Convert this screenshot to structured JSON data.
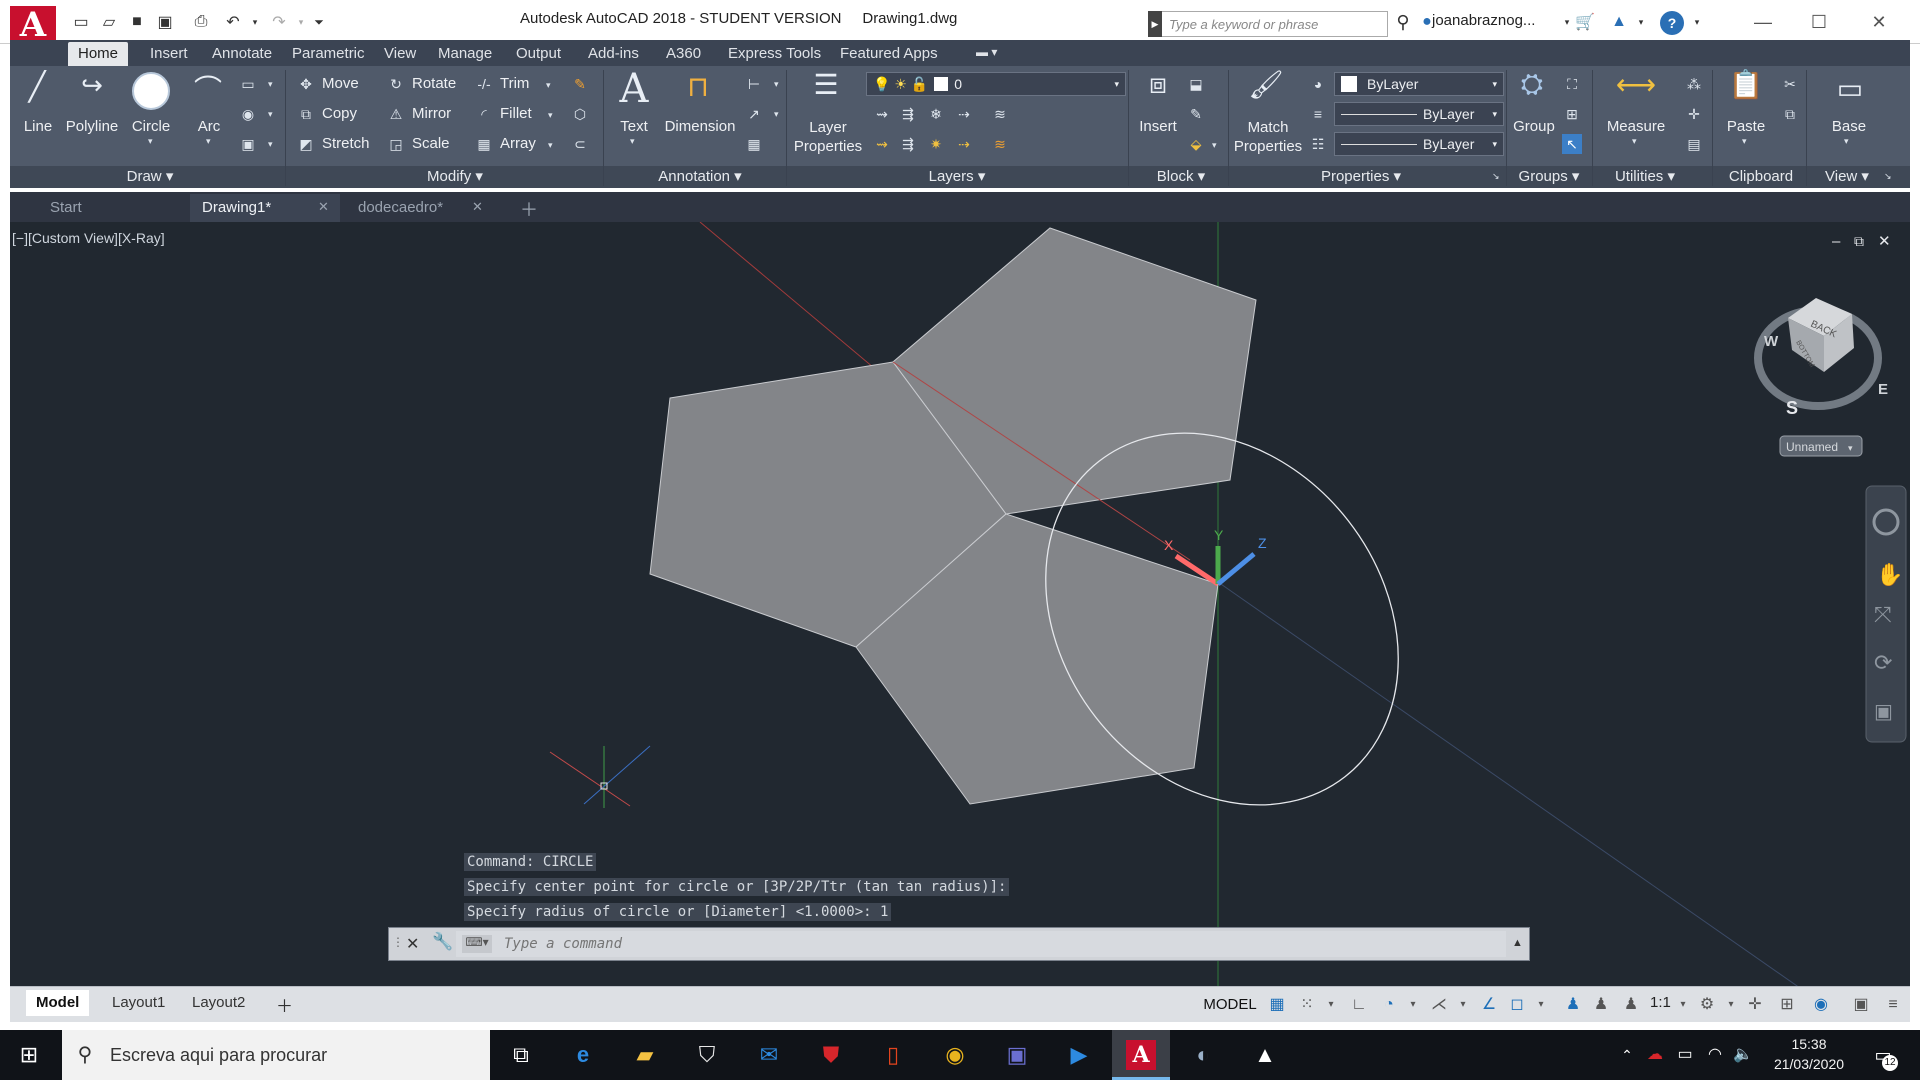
{
  "window": {
    "title": "Autodesk AutoCAD 2018 - STUDENT VERSION     Drawing1.dwg",
    "app_logo": "A",
    "search_placeholder": "Type a keyword or phrase",
    "username": "joanabraznog...",
    "help": "?"
  },
  "ribbon_tabs": [
    "Home",
    "Insert",
    "Annotate",
    "Parametric",
    "View",
    "Manage",
    "Output",
    "Add-ins",
    "A360",
    "Express Tools",
    "Featured Apps"
  ],
  "draw_panel": {
    "title": "Draw",
    "tools": [
      "Line",
      "Polyline",
      "Circle",
      "Arc"
    ]
  },
  "modify_panel": {
    "title": "Modify",
    "tools": [
      "Move",
      "Rotate",
      "Trim",
      "Copy",
      "Mirror",
      "Fillet",
      "Stretch",
      "Scale",
      "Array"
    ]
  },
  "annotation_panel": {
    "title": "Annotation",
    "tools": [
      "Text",
      "Dimension"
    ]
  },
  "layers_panel": {
    "title": "Layers",
    "layer_properties": "Layer\nProperties",
    "current_layer": "0"
  },
  "block_panel": {
    "title": "Block",
    "insert": "Insert"
  },
  "properties_panel": {
    "title": "Properties",
    "match_properties": "Match\nProperties",
    "color": "ByLayer",
    "linetype": "ByLayer",
    "lineweight": "ByLayer"
  },
  "groups_panel": {
    "title": "Groups",
    "group": "Group"
  },
  "utilities_panel": {
    "title": "Utilities",
    "measure": "Measure"
  },
  "clipboard_panel": {
    "title": "Clipboard",
    "paste": "Paste"
  },
  "view_panel": {
    "title": "View",
    "base": "Base"
  },
  "file_tabs": [
    "Start",
    "Drawing1*",
    "dodecaedro*"
  ],
  "viewport": {
    "label": "[−][Custom View][X-Ray]",
    "viewcube_face": "BACK",
    "viewcube_side": "BOTTOM",
    "compass": [
      "W",
      "E",
      "S"
    ],
    "ucs_name": "Unnamed",
    "ucs_axes": [
      "X",
      "Y",
      "Z"
    ]
  },
  "command_history": [
    "Command: CIRCLE",
    "Specify center point for circle or [3P/2P/Ttr (tan tan radius)]:",
    "Specify radius of circle or [Diameter] <1.0000>: 1"
  ],
  "command_placeholder": "Type a command",
  "layout_tabs": [
    "Model",
    "Layout1",
    "Layout2"
  ],
  "status": {
    "model": "MODEL",
    "scale": "1:1"
  },
  "taskbar": {
    "search_placeholder": "Escreva aqui para procurar",
    "time": "15:38",
    "date": "21/03/2020",
    "notifications": "12"
  },
  "colors": {
    "autocad_red": "#c8102e",
    "ribbon_bg": "#505a6a",
    "viewport_bg": "#212830",
    "face_gray": "#838589"
  }
}
